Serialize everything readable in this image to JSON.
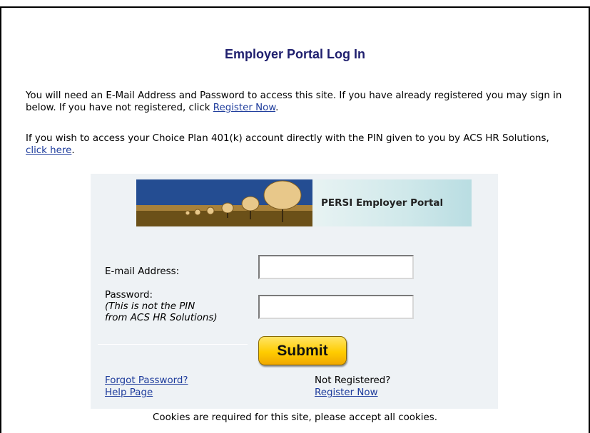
{
  "page": {
    "title": "Employer Portal Log In"
  },
  "intro": {
    "line1_text": "You will need an E-Mail Address and Password to access this site. If you have already registered you may sign in below. If you have not registered, click ",
    "line1_link": "Register Now",
    "line1_end": ".",
    "line2_text": "If you wish to access your Choice Plan 401(k) account directly with the PIN given to you by ACS HR Solutions, ",
    "line2_link": "click here",
    "line2_end": "."
  },
  "banner": {
    "text": "PERSI Employer Portal"
  },
  "form": {
    "email_label": "E-mail Address:",
    "email_value": "",
    "password_label": "Password:",
    "password_note_line1": "(This is not the PIN",
    "password_note_line2": "from ACS HR Solutions)",
    "password_value": "",
    "submit_label": "Submit"
  },
  "links": {
    "forgot_password": "Forgot Password?",
    "help_page": "Help Page",
    "not_registered": "Not Registered?",
    "register_now": "Register Now"
  },
  "footer": {
    "cookies_notice": "Cookies are required for this site, please accept all cookies."
  },
  "colors": {
    "title": "#1f1f6e",
    "link": "#1e3c9c",
    "panel_bg": "#eef2f5",
    "submit_button": "#ffcc00"
  },
  "icons": {
    "banner_image": "satellite-dish-array"
  }
}
